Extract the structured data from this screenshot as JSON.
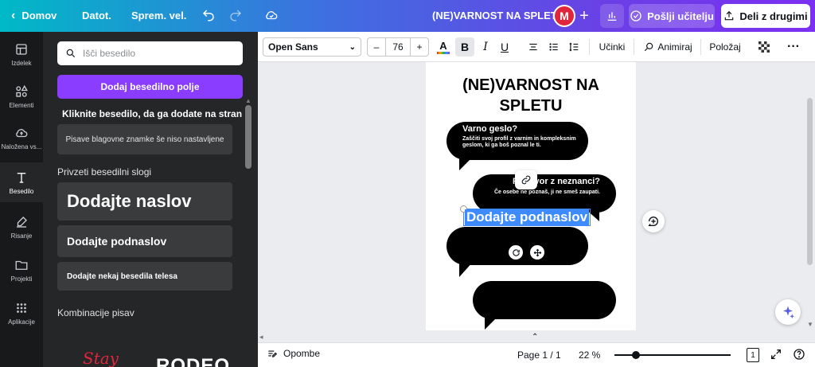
{
  "topbar": {
    "home": "Domov",
    "file": "Datot.",
    "resize": "Sprem. vel.",
    "doc_title": "(NE)VARNOST NA SPLETU",
    "avatar": "M",
    "send_teacher": "Pošlji učitelju",
    "share": "Deli z drugimi"
  },
  "rail": {
    "items": [
      "Izdelek",
      "Elementi",
      "Naložena vs...",
      "Besedilo",
      "Risanje",
      "Projekti",
      "Aplikacije"
    ]
  },
  "panel": {
    "search_placeholder": "Išči besedilo",
    "add_button": "Dodaj besedilno polje",
    "click_hint": "Kliknite besedilo, da ga dodate na stran",
    "brand_fonts": "Pisave blagovne znamke še niso nastavljene",
    "default_styles": "Privzeti besedilni slogi",
    "heading": "Dodajte naslov",
    "subheading": "Dodajte podnaslov",
    "body": "Dodajte nekaj besedila telesa",
    "combinations": "Kombinacije pisav",
    "combo1": "Stay",
    "combo2": "RODEO"
  },
  "toolbar": {
    "font": "Open Sans",
    "size": "76",
    "effects": "Učinki",
    "animate": "Animiraj",
    "position": "Položaj"
  },
  "page": {
    "title": "(NE)VARNOST NA SPLETU",
    "bubble1_title": "Varno geslo?",
    "bubble1_text": "Zaščiti svoj profil z varnim in kompleksnim geslom, ki ga boš poznal le ti.",
    "bubble2_title": "Pogovor z neznanci?",
    "bubble2_text": "Če osebe ne poznaš, ji ne smeš zaupati.",
    "selected_text": "Dodajte podnaslov"
  },
  "bottom": {
    "notes": "Opombe",
    "page": "Page 1 / 1",
    "zoom": "22 %",
    "page_count": "1"
  },
  "colors": {
    "accent": "#8b3dff",
    "selection": "#3d8bff",
    "avatar": "#e0263c"
  }
}
